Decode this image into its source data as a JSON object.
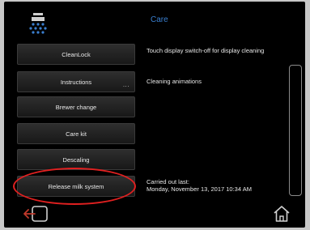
{
  "header": {
    "title": "Care"
  },
  "menu": [
    {
      "label": "CleanLock",
      "description": "Touch display switch-off for display cleaning"
    },
    {
      "label": "Instructions",
      "more": "...",
      "description": "Cleaning animations"
    },
    {
      "label": "Brewer change"
    },
    {
      "label": "Care kit"
    },
    {
      "label": "Descaling"
    },
    {
      "label": "Release milk system",
      "description_label": "Carried out last:",
      "description_value": "Monday, November 13, 2017 10:34 AM"
    }
  ],
  "icons": {
    "logo": "shower-head-icon",
    "back": "back-exit-icon",
    "home": "home-icon"
  },
  "colors": {
    "accent": "#3a7fd0",
    "highlight": "#e02020",
    "back_icon": "#c0392b"
  }
}
